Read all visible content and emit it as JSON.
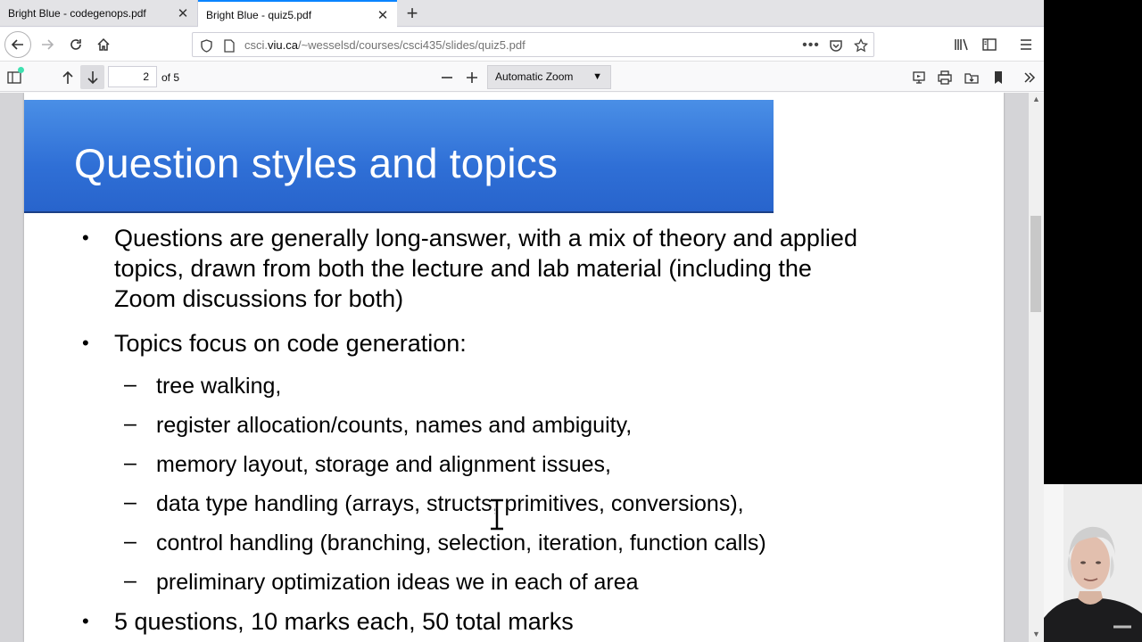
{
  "tabs": [
    {
      "title": "Bright Blue - codegenops.pdf",
      "active": false
    },
    {
      "title": "Bright Blue - quiz5.pdf",
      "active": true
    }
  ],
  "navbar": {
    "url_prefix": "csci.",
    "url_host": "viu.ca",
    "url_path": "/~wesselsd/courses/csci435/slides/quiz5.pdf"
  },
  "pdf_toolbar": {
    "page_number": "2",
    "page_count": "of 5",
    "zoom": "Automatic Zoom"
  },
  "slide": {
    "title": "Question styles and topics",
    "bullets": {
      "b1_l1": "Questions are generally long-answer, with a mix of theory and applied",
      "b1_l2": "topics, drawn from both the lecture and lab material (including the",
      "b1_l3": "Zoom discussions for both)",
      "b2": "Topics focus on code generation:",
      "b3": "5 questions, 10 marks each, 50 total marks"
    },
    "subitems": [
      "tree walking,",
      "register allocation/counts, names and ambiguity,",
      "memory layout, storage and alignment issues,",
      "data type handling (arrays, structs, primitives, conversions),",
      "control handling (branching, selection, iteration, function calls)",
      "preliminary optimization ideas we in each of area"
    ],
    "bullet_glyph": "•",
    "dash_glyph": "–"
  },
  "colors": {
    "title_band": "#2f6fd6",
    "active_tab_accent": "#0a84ff"
  }
}
